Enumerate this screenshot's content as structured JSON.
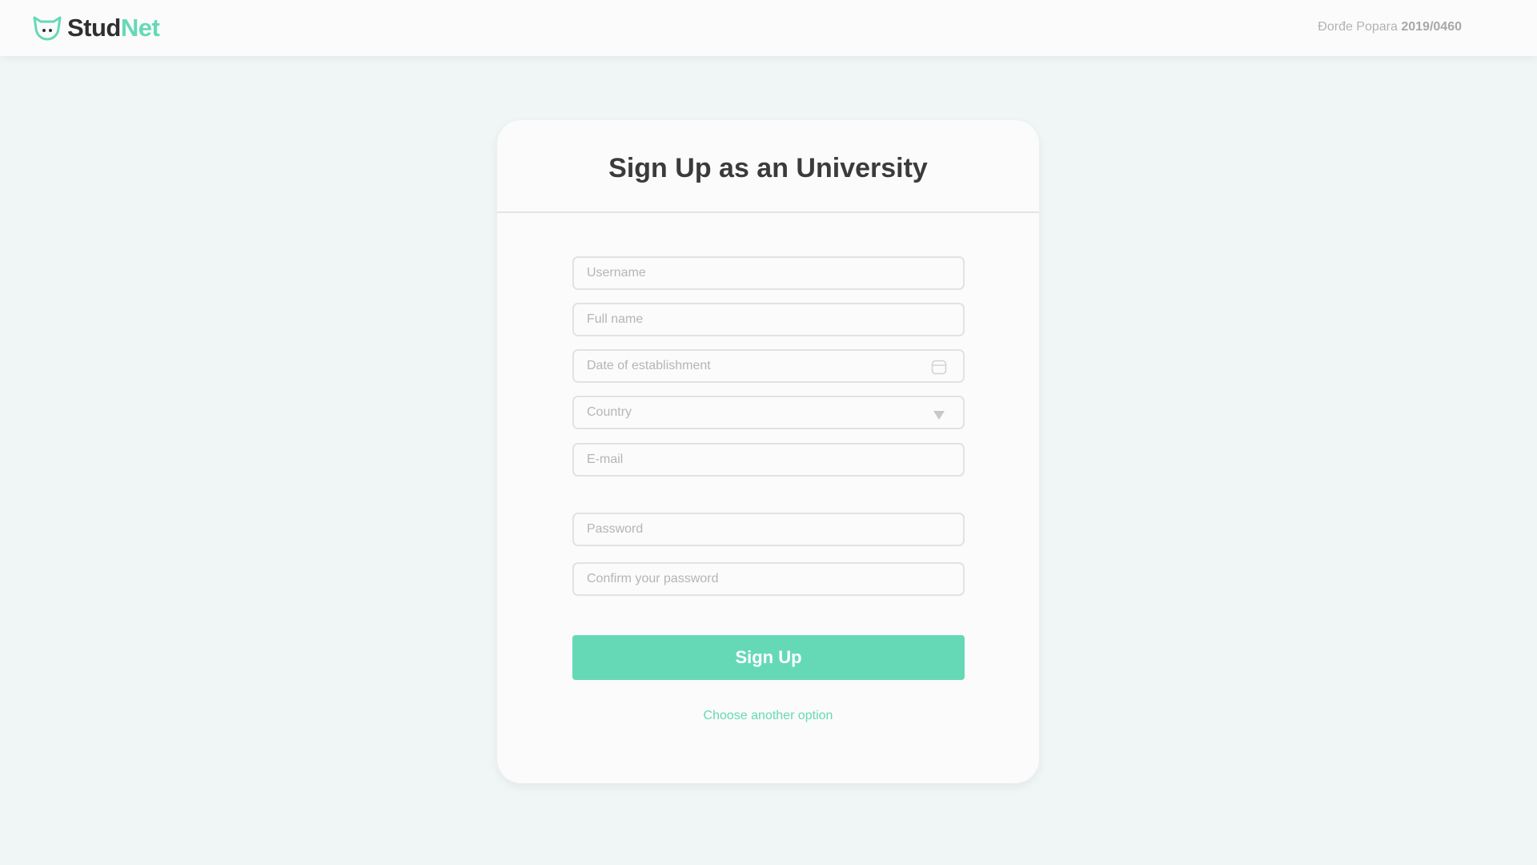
{
  "brand": {
    "name_part1": "Stud",
    "name_part2": "Net",
    "accent_color": "#65d9b6",
    "dark_color": "#2f2f2f"
  },
  "header": {
    "user_name": "Đorđe Popara",
    "user_id": "2019/0460"
  },
  "form": {
    "title": "Sign Up as an University",
    "username_placeholder": "Username",
    "fullname_placeholder": "Full name",
    "date_placeholder": "Date of establishment",
    "country_label": "Country",
    "email_placeholder": "E-mail",
    "password_placeholder": "Password",
    "confirm_password_placeholder": "Confirm your password",
    "submit_label": "Sign Up",
    "other_option_label": "Choose another option"
  },
  "icons": {
    "logo": "cat-face-icon",
    "date": "calendar-icon",
    "country": "dropdown-triangle-icon"
  }
}
